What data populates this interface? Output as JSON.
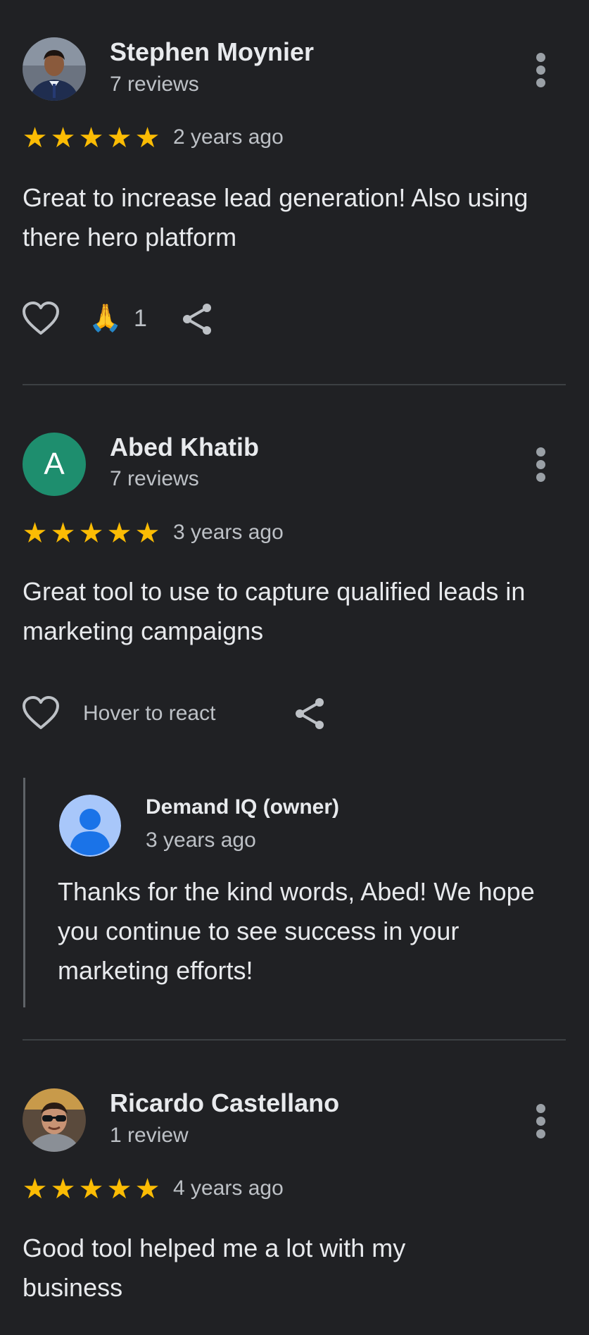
{
  "colors": {
    "background": "#202124",
    "star": "#fbbc04",
    "letter_avatar": "#1e8e6e",
    "divider": "#3c4043"
  },
  "reviews": [
    {
      "name": "Stephen Moynier",
      "review_count": "7 reviews",
      "rating": 5,
      "stars": "★★★★★",
      "date": "2 years ago",
      "text": "Great to increase lead generation! Also using there hero platform",
      "avatar": "profile-photo",
      "reaction_emoji": "🙏",
      "reaction_count": "1",
      "icons": [
        "heart-outline-icon",
        "share-icon",
        "more-vert-icon"
      ]
    },
    {
      "name": "Abed Khatib",
      "review_count": "7 reviews",
      "rating": 5,
      "stars": "★★★★★",
      "date": "3 years ago",
      "text": "Great tool to use to capture qualified leads in marketing campaigns",
      "avatar_letter": "A",
      "hover_text": "Hover to react",
      "icons": [
        "heart-outline-icon",
        "share-icon",
        "more-vert-icon"
      ],
      "owner_reply": {
        "name": "Demand IQ (owner)",
        "date": "3 years ago",
        "text": "Thanks for the kind words, Abed! We hope you continue to see success in your marketing efforts!",
        "avatar": "default-user-icon"
      }
    },
    {
      "name": "Ricardo Castellano",
      "review_count": "1 review",
      "rating": 5,
      "stars": "★★★★★",
      "date": "4 years ago",
      "text": "Good tool helped me a lot with my business",
      "avatar": "profile-photo",
      "icons": [
        "more-vert-icon"
      ]
    }
  ]
}
